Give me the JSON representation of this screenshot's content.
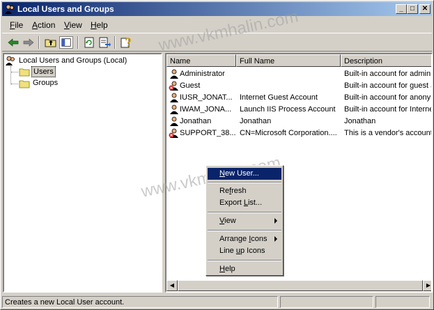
{
  "window": {
    "title": "Local Users and Groups"
  },
  "titlebar": {
    "min_glyph": "_",
    "max_glyph": "□",
    "close_glyph": "✕"
  },
  "menubar": [
    {
      "key": "F",
      "rest": "ile"
    },
    {
      "key": "A",
      "rest": "ction"
    },
    {
      "key": "V",
      "rest": "iew"
    },
    {
      "key": "H",
      "rest": "elp"
    }
  ],
  "toolbar_icons": [
    "back-arrow-icon",
    "forward-arrow-icon",
    "up-folder-icon",
    "show-hide-tree-icon",
    "refresh-icon",
    "export-list-icon",
    "help-icon"
  ],
  "tree": {
    "root": "Local Users and Groups (Local)",
    "children": [
      "Users",
      "Groups"
    ]
  },
  "list": {
    "columns": [
      "Name",
      "Full Name",
      "Description"
    ],
    "rows": [
      {
        "name": "Administrator",
        "full_name": "",
        "description": "Built-in account for adminis",
        "disabled": false
      },
      {
        "name": "Guest",
        "full_name": "",
        "description": "Built-in account for guest a",
        "disabled": true
      },
      {
        "name": "IUSR_JONAT...",
        "full_name": "Internet Guest Account",
        "description": "Built-in account for anonym",
        "disabled": false
      },
      {
        "name": "IWAM_JONA...",
        "full_name": "Launch IIS Process Account",
        "description": "Built-in account for Interne",
        "disabled": false
      },
      {
        "name": "Jonathan",
        "full_name": "Jonathan",
        "description": "Jonathan",
        "disabled": false
      },
      {
        "name": "SUPPORT_38...",
        "full_name": "CN=Microsoft Corporation....",
        "description": "This is a vendor's account",
        "disabled": true
      }
    ]
  },
  "context_menu": {
    "new_user": {
      "pre": "",
      "key": "N",
      "post": "ew User..."
    },
    "refresh": {
      "pre": "Re",
      "key": "f",
      "post": "resh"
    },
    "export_list": {
      "pre": "Export ",
      "key": "L",
      "post": "ist..."
    },
    "view": {
      "pre": "",
      "key": "V",
      "post": "iew"
    },
    "arrange_icons": {
      "pre": "Arrange ",
      "key": "I",
      "post": "cons"
    },
    "line_up_icons": {
      "pre": "Line ",
      "key": "u",
      "post": "p Icons"
    },
    "help": {
      "pre": "",
      "key": "H",
      "post": "elp"
    }
  },
  "status": {
    "text": "Creates a new Local User account."
  },
  "watermark": {
    "text": "www.vkmhalin.com"
  },
  "colors": {
    "title_start": "#0a246a",
    "title_end": "#a6caf0",
    "face": "#d4d0c8",
    "highlight": "#0a246a"
  }
}
